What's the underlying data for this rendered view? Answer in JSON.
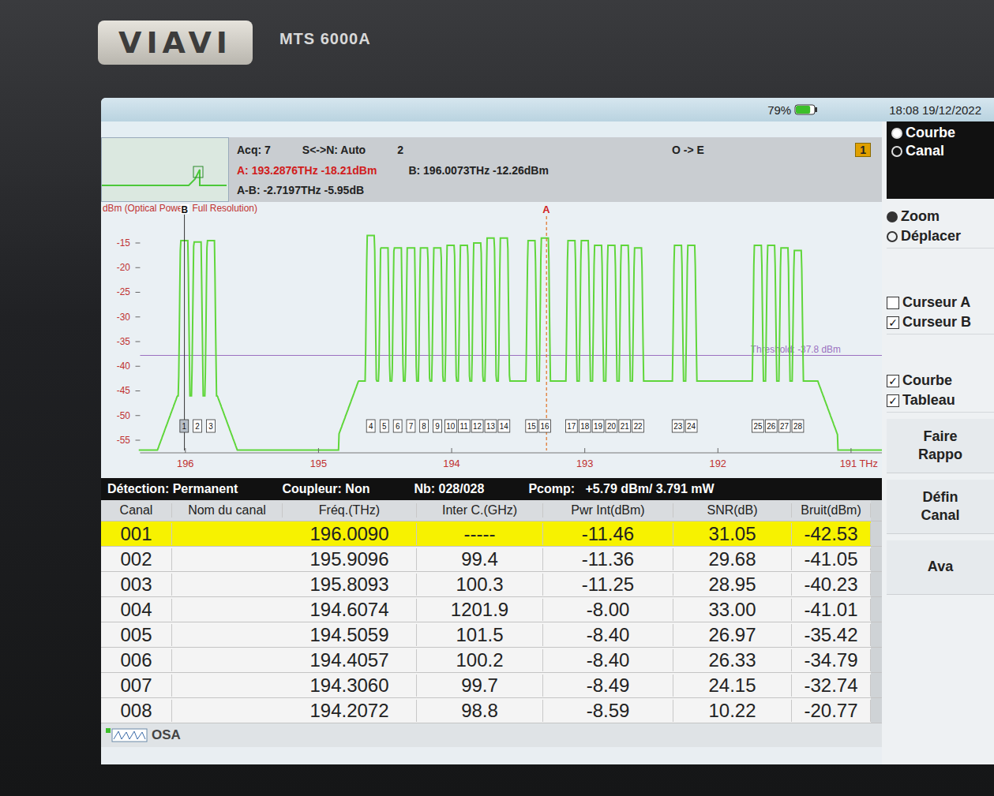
{
  "device": {
    "brand": "VIAVI",
    "model": "MTS 6000A"
  },
  "status_bar": {
    "battery": "79%",
    "battery_level": 0.79,
    "clock": "18:08 19/12/2022"
  },
  "info": {
    "acq": "Acq: 7",
    "sn": "S<->N: Auto",
    "trace": "2",
    "direction": "O -> E",
    "page": "1",
    "cursor_a": "A: 193.2876THz -18.21dBm",
    "cursor_b": "B: 196.0073THz -12.26dBm",
    "delta": "A-B: -2.7197THz -5.95dB"
  },
  "side_panel": {
    "view_options": [
      {
        "label": "Courbe",
        "selected": true
      },
      {
        "label": "Canal",
        "selected": false
      }
    ],
    "mode_options": [
      {
        "label": "Zoom",
        "selected": true
      },
      {
        "label": "Déplacer",
        "selected": false
      }
    ],
    "cursor_checks": [
      {
        "label": "Curseur A",
        "checked": false
      },
      {
        "label": "Curseur B",
        "checked": true
      }
    ],
    "display_checks": [
      {
        "label": "Courbe",
        "checked": true
      },
      {
        "label": "Tableau",
        "checked": true
      }
    ],
    "buttons": [
      "Faire Rappo",
      "Défin Canal",
      "Ava"
    ]
  },
  "chart": {
    "y_label": "dBm (Optical Power",
    "x_label": "Full Resolution)",
    "y_ticks": [
      "-15",
      "-20",
      "-25",
      "-30",
      "-35",
      "-40",
      "-45",
      "-50",
      "-55"
    ],
    "x_ticks": [
      "196",
      "195",
      "194",
      "193",
      "192",
      "191 THz"
    ],
    "cursor_a_label": "A",
    "cursor_b_label": "B",
    "cursor_a_freq": 193.2876,
    "cursor_b_freq": 196.0073,
    "threshold": {
      "label": "Threshold: -37.8 dBm",
      "value": -37.8
    },
    "ase_bands": [
      {
        "start": 196.06,
        "end": 195.76,
        "level": -46
      },
      {
        "start": 194.7,
        "end": 191.25,
        "level": -43
      }
    ],
    "base_level": -57,
    "channels": [
      {
        "label": "1",
        "freq": 196.009,
        "peak": -14.5
      },
      {
        "label": "2",
        "freq": 195.9096,
        "peak": -14.8
      },
      {
        "label": "3",
        "freq": 195.8093,
        "peak": -14.5
      },
      {
        "label": "4",
        "freq": 194.6074,
        "peak": -13.5
      },
      {
        "label": "5",
        "freq": 194.5059,
        "peak": -16
      },
      {
        "label": "6",
        "freq": 194.4057,
        "peak": -16
      },
      {
        "label": "7",
        "freq": 194.306,
        "peak": -16
      },
      {
        "label": "8",
        "freq": 194.2072,
        "peak": -16
      },
      {
        "label": "9",
        "freq": 194.107,
        "peak": -16
      },
      {
        "label": "10",
        "freq": 194.007,
        "peak": -15.5
      },
      {
        "label": "11",
        "freq": 193.907,
        "peak": -15.5
      },
      {
        "label": "12",
        "freq": 193.807,
        "peak": -15
      },
      {
        "label": "13",
        "freq": 193.707,
        "peak": -14
      },
      {
        "label": "14",
        "freq": 193.607,
        "peak": -14
      },
      {
        "label": "15",
        "freq": 193.4,
        "peak": -14.5
      },
      {
        "label": "16",
        "freq": 193.3,
        "peak": -14
      },
      {
        "label": "17",
        "freq": 193.1,
        "peak": -14.5
      },
      {
        "label": "18",
        "freq": 193.0,
        "peak": -14.5
      },
      {
        "label": "19",
        "freq": 192.9,
        "peak": -15.5
      },
      {
        "label": "20",
        "freq": 192.8,
        "peak": -15.5
      },
      {
        "label": "21",
        "freq": 192.7,
        "peak": -15.5
      },
      {
        "label": "22",
        "freq": 192.6,
        "peak": -16
      },
      {
        "label": "23",
        "freq": 192.3,
        "peak": -15.5
      },
      {
        "label": "24",
        "freq": 192.2,
        "peak": -15.5
      },
      {
        "label": "25",
        "freq": 191.7,
        "peak": -15.5
      },
      {
        "label": "26",
        "freq": 191.6,
        "peak": -15.5
      },
      {
        "label": "27",
        "freq": 191.5,
        "peak": -16
      },
      {
        "label": "28",
        "freq": 191.4,
        "peak": -16.5
      }
    ]
  },
  "table_bar": {
    "detection": "Détection: Permanent",
    "coupler": "Coupleur: Non",
    "count": "Nb: 028/028",
    "pcomp_label": "Pcomp:",
    "pcomp": "+5.79 dBm/ 3.791 mW"
  },
  "table": {
    "columns": [
      "Canal",
      "Nom du canal",
      "Fréq.(THz)",
      "Inter C.(GHz)",
      "Pwr Int(dBm)",
      "SNR(dB)",
      "Bruit(dBm)"
    ],
    "rows": [
      {
        "cells": [
          "001",
          "",
          "196.0090",
          "-----",
          "-11.46",
          "31.05",
          "-42.53"
        ],
        "selected": true
      },
      {
        "cells": [
          "002",
          "",
          "195.9096",
          "99.4",
          "-11.36",
          "29.68",
          "-41.05"
        ],
        "selected": false
      },
      {
        "cells": [
          "003",
          "",
          "195.8093",
          "100.3",
          "-11.25",
          "28.95",
          "-40.23"
        ],
        "selected": false
      },
      {
        "cells": [
          "004",
          "",
          "194.6074",
          "1201.9",
          "-8.00",
          "33.00",
          "-41.01"
        ],
        "selected": false
      },
      {
        "cells": [
          "005",
          "",
          "194.5059",
          "101.5",
          "-8.40",
          "26.97",
          "-35.42"
        ],
        "selected": false
      },
      {
        "cells": [
          "006",
          "",
          "194.4057",
          "100.2",
          "-8.40",
          "26.33",
          "-34.79"
        ],
        "selected": false
      },
      {
        "cells": [
          "007",
          "",
          "194.3060",
          "99.7",
          "-8.49",
          "24.15",
          "-32.74"
        ],
        "selected": false
      },
      {
        "cells": [
          "008",
          "",
          "194.2072",
          "98.8",
          "-8.59",
          "10.22",
          "-20.77"
        ],
        "selected": false
      }
    ]
  },
  "bottom_bar": {
    "tab": "OSA"
  }
}
